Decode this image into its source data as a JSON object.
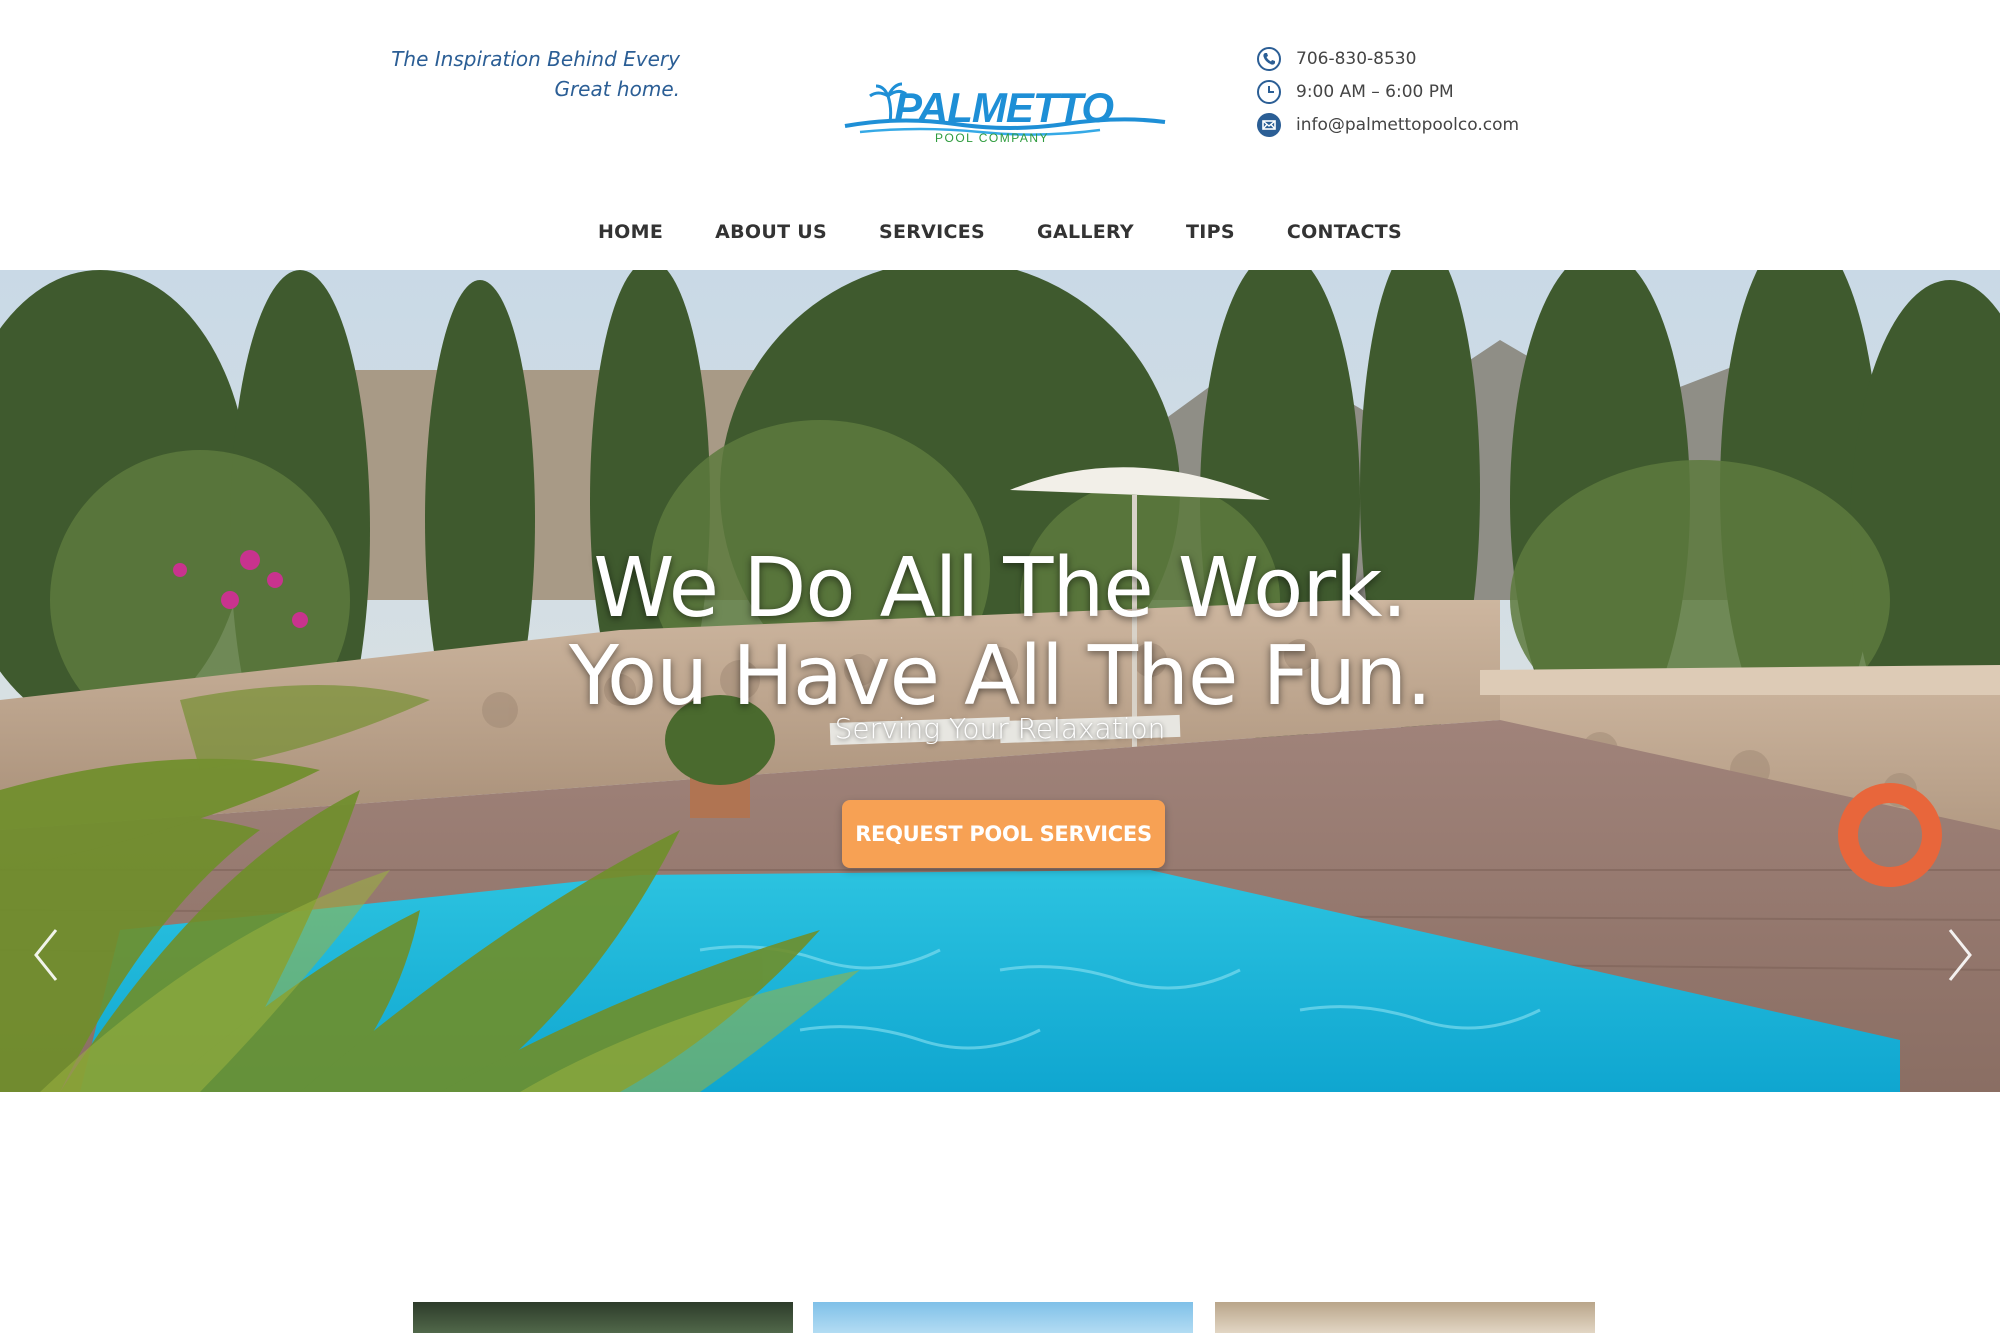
{
  "header": {
    "tagline": "The Inspiration Behind Every Great home.",
    "logo": {
      "name": "PALMETTO",
      "subtitle": "POOL COMPANY"
    },
    "contact": {
      "phone": "706-830-8530",
      "hours": "9:00 AM – 6:00 PM",
      "email": "info@palmettopoolco.com"
    }
  },
  "nav": {
    "items": [
      {
        "label": "HOME"
      },
      {
        "label": "ABOUT US"
      },
      {
        "label": "SERVICES"
      },
      {
        "label": "GALLERY"
      },
      {
        "label": "TIPS"
      },
      {
        "label": "CONTACTS"
      }
    ]
  },
  "hero": {
    "title_line1": "We Do All The Work.",
    "title_line2": "You Have All The Fun.",
    "subtitle": "Serving Your Relaxation",
    "cta_label": "REQUEST POOL SERVICES"
  },
  "colors": {
    "brand_blue": "#2b5e95",
    "logo_blue": "#1e8fd6",
    "cta_orange": "#f7a154",
    "nav_text": "#333333"
  }
}
